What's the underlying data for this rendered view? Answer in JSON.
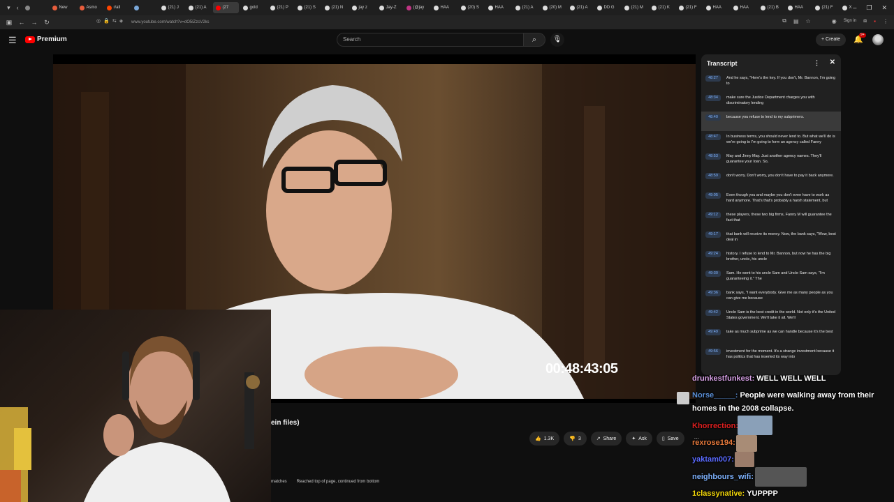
{
  "browser": {
    "tabs": [
      {
        "label": "",
        "color": "#888888"
      },
      {
        "label": "New",
        "color": "#e85d3c"
      },
      {
        "label": "Asmo",
        "color": "#e85d3c"
      },
      {
        "label": "r/all",
        "color": "#ff4500"
      },
      {
        "label": "",
        "color": "#7aa7d8"
      },
      {
        "label": "(21) J",
        "color": "#dddddd"
      },
      {
        "label": "(21) A",
        "color": "#dddddd"
      },
      {
        "label": "(27",
        "color": "#ff0000",
        "active": true
      },
      {
        "label": "gold",
        "color": "#dddddd"
      },
      {
        "label": "(21) P",
        "color": "#dddddd"
      },
      {
        "label": "(21) S",
        "color": "#dddddd"
      },
      {
        "label": "(21) N",
        "color": "#dddddd"
      },
      {
        "label": "jay z",
        "color": "#dddddd"
      },
      {
        "label": "Jay-Z",
        "color": "#dddddd"
      },
      {
        "label": "(@jay",
        "color": "#c13584"
      },
      {
        "label": "HAA",
        "color": "#dddddd"
      },
      {
        "label": "(20) S",
        "color": "#dddddd"
      },
      {
        "label": "HAA",
        "color": "#dddddd"
      },
      {
        "label": "(21) A",
        "color": "#dddddd"
      },
      {
        "label": "(20) M",
        "color": "#dddddd"
      },
      {
        "label": "(21) A",
        "color": "#dddddd"
      },
      {
        "label": "DD G",
        "color": "#dddddd"
      },
      {
        "label": "(21) M",
        "color": "#dddddd"
      },
      {
        "label": "(21) K",
        "color": "#dddddd"
      },
      {
        "label": "(21) F",
        "color": "#dddddd"
      },
      {
        "label": "HAA",
        "color": "#dddddd"
      },
      {
        "label": "HAA",
        "color": "#dddddd"
      },
      {
        "label": "(21) B",
        "color": "#dddddd"
      },
      {
        "label": "HAA",
        "color": "#dddddd"
      },
      {
        "label": "(21) F",
        "color": "#dddddd"
      },
      {
        "label": "X",
        "color": "#dddddd"
      }
    ],
    "url": "www.youtube.com/watch?v=dO5lZzcV2ks",
    "sign_in": "Sign in"
  },
  "youtube": {
    "brand": "Premium",
    "search_placeholder": "Search",
    "create_label": "Create",
    "notif_count": "9+",
    "timecode": "00:48:43:05",
    "video_title_fragment": "ein files)",
    "likes": "1.3K",
    "dislikes": "3",
    "share_label": "Share",
    "ask_label": "Ask",
    "save_label": "Save",
    "find_matches": "matches",
    "find_status": "Reached top of page, continued from bottom"
  },
  "transcript": {
    "title": "Transcript",
    "segments": [
      {
        "ts": "48:27",
        "text": "And he says, \"Here's the key. If you don't, Mr. Bannon, I'm going to"
      },
      {
        "ts": "48:34",
        "text": "make sure the Justice Department charges you with discriminatory lending"
      },
      {
        "ts": "48:40",
        "text": "because you refuse to lend to my subprimers.",
        "active": true
      },
      {
        "ts": "48:47",
        "text": "In business terms, you should never lend to. But what we'll do is we're going to I'm going to form an agency called Fanny"
      },
      {
        "ts": "48:53",
        "text": "May and Jinny May. Just another agency names. They'll guarantee your loan. So,"
      },
      {
        "ts": "48:59",
        "text": "don't worry. Don't worry, you don't have to pay it back anymore."
      },
      {
        "ts": "49:05",
        "text": "Even though you and maybe you don't even have to work as hard anymore. That's that's probably a harsh statement, but"
      },
      {
        "ts": "49:12",
        "text": "these players, these two big firms, Fanny M will guarantee the fact that"
      },
      {
        "ts": "49:17",
        "text": "that bank will receive its money. Now, the bank says, \"Wow, best deal in"
      },
      {
        "ts": "49:24",
        "text": "history. I refuse to lend to Mr. Bannon, but now he has the big brother, uncle, his uncle"
      },
      {
        "ts": "49:30",
        "text": "Sam. He went to his uncle Sam and Uncle Sam says, \"I'm guaranteeing it.\" The"
      },
      {
        "ts": "49:36",
        "text": "bank says, \"I want everybody. Give me as many people as you can give me because"
      },
      {
        "ts": "49:42",
        "text": "Uncle Sam is the best credit in the world. Not only it's the United States government. We'll take it all. We'll"
      },
      {
        "ts": "49:49",
        "text": "take as much subprime as we can handle because it's the best"
      },
      {
        "ts": "49:56",
        "text": "investment for the moment. It's a strange investment because it has politics that has inserted its way into"
      }
    ]
  },
  "chat": {
    "messages": [
      {
        "user": "drunkestfunkest:",
        "text": "WELL WELL WELL",
        "color": "#d9a2e8"
      },
      {
        "user": "Norse_____:",
        "text": "People were walking away from their",
        "text2": "homes in the 2008 collapse.",
        "color": "#5b8fd6"
      },
      {
        "user": "Khorrection:",
        "text": "",
        "color": "#e02020"
      },
      {
        "user": "rexrose194:",
        "text": "",
        "color": "#e87a3c"
      },
      {
        "user": "yaktam007:",
        "text": "",
        "color": "#5b6bff"
      },
      {
        "user": "neighbours_wifi:",
        "text": "",
        "color": "#7fb3ff"
      },
      {
        "user": "1classynative:",
        "text": "YUPPPP",
        "color": "#f5d90a"
      }
    ]
  }
}
